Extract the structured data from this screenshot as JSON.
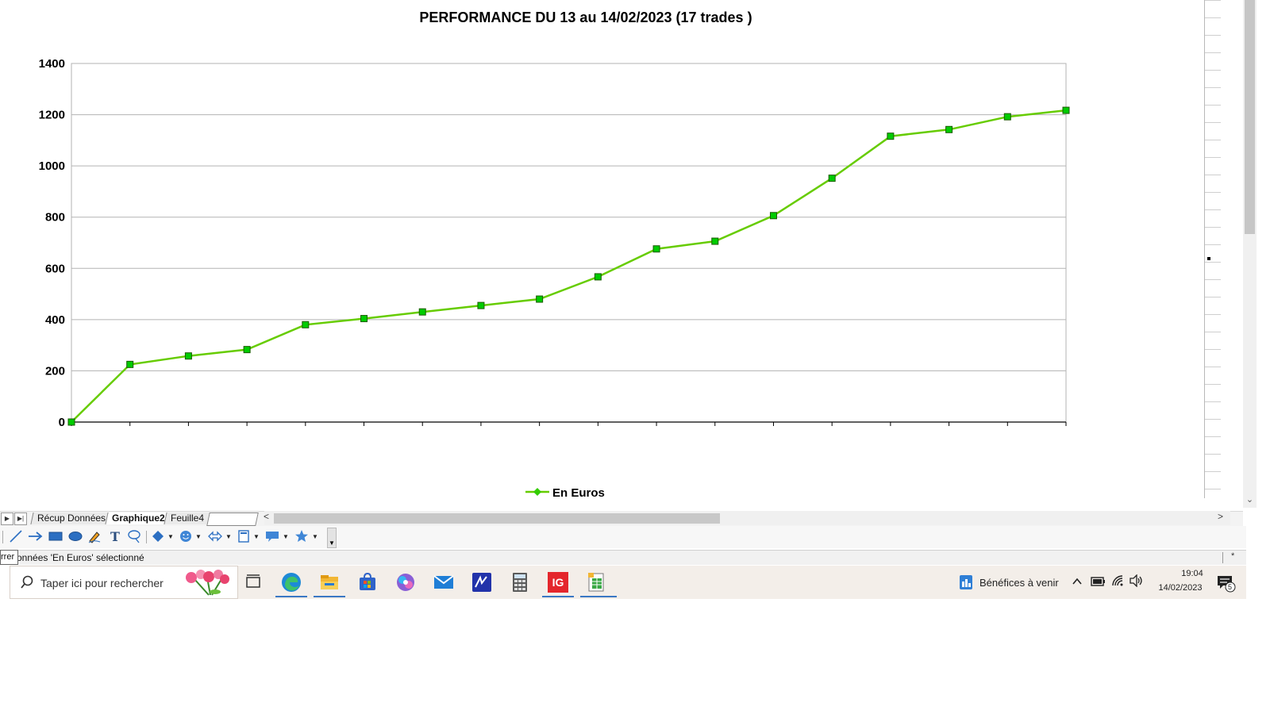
{
  "chart_data": {
    "type": "line",
    "title": "PERFORMANCE DU 13 au 14/02/2023 (17 trades )",
    "xlabel": "",
    "ylabel": "",
    "ylim": [
      0,
      1400
    ],
    "yticks": [
      0,
      200,
      400,
      600,
      800,
      1000,
      1200,
      1400
    ],
    "grid": true,
    "legend_position": "bottom",
    "series": [
      {
        "name": "En Euros",
        "color": "#66cc00",
        "marker_color": "#00cc00",
        "values": [
          0,
          225,
          258,
          283,
          380,
          404,
          430,
          455,
          480,
          567,
          676,
          706,
          806,
          952,
          1116,
          1142,
          1192,
          1217
        ]
      }
    ]
  },
  "sheet_tabs": {
    "items": [
      "Récup Données",
      "Graphique2",
      "Feuille4"
    ],
    "active": "Graphique2"
  },
  "drawing_toolbar": {
    "icons": [
      "line-icon",
      "arrow-icon",
      "rectangle-icon",
      "ellipse-icon",
      "freeform-icon",
      "text-icon",
      "callout-icon",
      "diamond-shapes-icon",
      "smiley-icon",
      "double-arrow-icon",
      "flowchart-icon",
      "speech-bubble-icon",
      "star-icon"
    ]
  },
  "status_bar": {
    "tooltip_fragment": "rrer",
    "text": "onnées 'En Euros' sélectionné",
    "star": "*"
  },
  "taskbar": {
    "search_placeholder": "Taper ici pour rechercher",
    "apps": [
      "task-view-icon",
      "edge-icon",
      "file-explorer-icon",
      "store-icon",
      "copilot-icon",
      "mail-icon",
      "app-m-icon",
      "calculator-icon",
      "ig-icon",
      "calc-spreadsheet-icon"
    ],
    "ig_label": "IG",
    "notification": "Bénéfices à venir",
    "time": "19:04",
    "date": "14/02/2023",
    "notif_count": "5"
  }
}
